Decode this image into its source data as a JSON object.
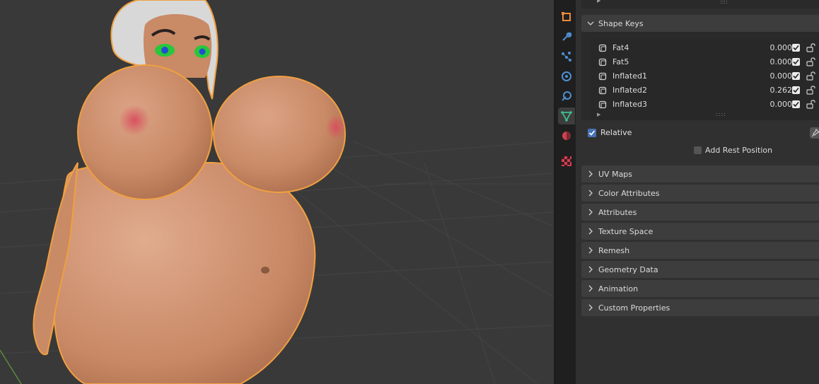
{
  "properties": {
    "shape_keys": {
      "title": "Shape Keys",
      "keys": [
        {
          "name": "Fat4",
          "value": "0.000",
          "enabled": true
        },
        {
          "name": "Fat5",
          "value": "0.000",
          "enabled": true
        },
        {
          "name": "Inflated1",
          "value": "0.000",
          "enabled": true
        },
        {
          "name": "Inflated2",
          "value": "0.262",
          "enabled": true
        },
        {
          "name": "Inflated3",
          "value": "0.000",
          "enabled": true
        }
      ],
      "relative_label": "Relative",
      "relative_checked": true,
      "add_rest_position_label": "Add Rest Position",
      "add_rest_position_checked": false
    },
    "collapsed_panels": [
      "UV Maps",
      "Color Attributes",
      "Attributes",
      "Texture Space",
      "Remesh",
      "Geometry Data",
      "Animation",
      "Custom Properties"
    ]
  },
  "tabs": [
    {
      "icon": "object-icon",
      "color": "#e98a3a",
      "active": false
    },
    {
      "icon": "modifier-wrench-icon",
      "color": "#4f8fd3",
      "active": false
    },
    {
      "icon": "particles-icon",
      "color": "#4f8fd3",
      "active": false
    },
    {
      "icon": "physics-icon",
      "color": "#4f8fd3",
      "active": false
    },
    {
      "icon": "constraints-icon",
      "color": "#4f8fd3",
      "active": false
    },
    {
      "icon": "mesh-data-icon",
      "color": "#3fbf8f",
      "active": true
    },
    {
      "icon": "material-icon",
      "color": "#d04050",
      "active": false
    },
    {
      "icon": "texture-icon",
      "color": "#d04050",
      "active": false
    }
  ],
  "colors": {
    "selection_outline": "#f0a040",
    "viewport_bg": "#393939",
    "panel_bg": "#303030",
    "accent_blue": "#4772b3"
  }
}
